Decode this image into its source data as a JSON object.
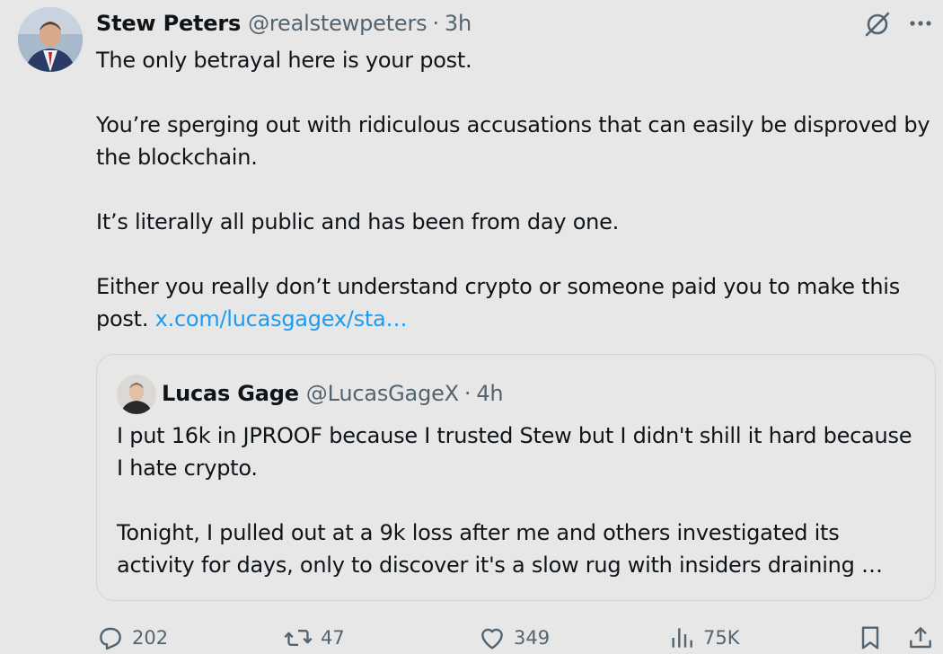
{
  "post": {
    "author_name": "Stew Peters",
    "author_handle": "@realstewpeters",
    "separator": "·",
    "timestamp": "3h",
    "paragraphs": [
      "The only betrayal here is your post.",
      "You’re sperging out with ridiculous accusations that can easily be disproved by the blockchain.",
      "It’s literally all public and has been from day one."
    ],
    "last_paragraph_text": "Either you really don’t understand crypto or someone paid you to make this post.",
    "link_text": "x.com/lucasgagex/sta…"
  },
  "quote": {
    "author_name": "Lucas Gage",
    "author_handle": "@LucasGageX",
    "separator": "·",
    "timestamp": "4h",
    "paragraphs": [
      "I put 16k in JPROOF because I trusted Stew but I didn't shill it hard because I hate crypto.",
      "Tonight, I pulled out at a 9k loss after me and others investigated its activity for days, only to discover it's a slow rug with insiders draining …"
    ]
  },
  "actions": {
    "replies": "202",
    "reposts": "47",
    "likes": "349",
    "views": "75K"
  },
  "icons": {
    "top_right": [
      "grok-icon",
      "more-icon"
    ],
    "action_bar": [
      "reply-icon",
      "repost-icon",
      "like-icon",
      "views-icon",
      "bookmark-icon",
      "share-icon"
    ]
  },
  "colors": {
    "background": "#e7e7e7",
    "text": "#0f1419",
    "secondary": "#536471",
    "link": "#1d9bf0"
  }
}
